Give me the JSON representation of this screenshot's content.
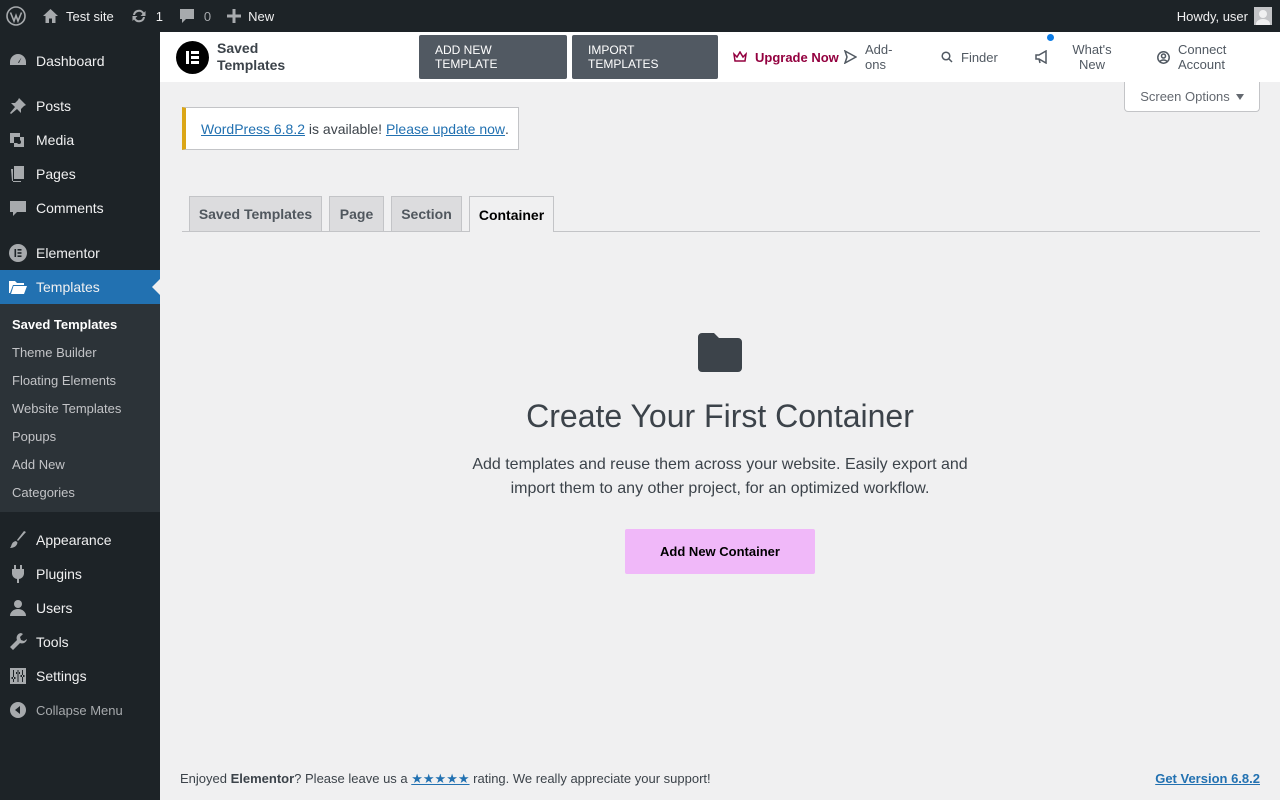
{
  "adminbar": {
    "site_name": "Test site",
    "updates_count": "1",
    "comments_count": "0",
    "new_label": "New",
    "howdy": "Howdy, user"
  },
  "sidebar": {
    "items_top": [
      {
        "label": "Dashboard",
        "icon": "dashboard-icon"
      }
    ],
    "items_mid": [
      {
        "label": "Posts",
        "icon": "pin-icon"
      },
      {
        "label": "Media",
        "icon": "media-icon"
      },
      {
        "label": "Pages",
        "icon": "pages-icon"
      },
      {
        "label": "Comments",
        "icon": "comment-icon"
      }
    ],
    "elementor": "Elementor",
    "templates": "Templates",
    "submenu": [
      "Saved Templates",
      "Theme Builder",
      "Floating Elements",
      "Website Templates",
      "Popups",
      "Add New",
      "Categories"
    ],
    "items_bottom": [
      {
        "label": "Appearance",
        "icon": "brush-icon"
      },
      {
        "label": "Plugins",
        "icon": "plug-icon"
      },
      {
        "label": "Users",
        "icon": "user-icon"
      },
      {
        "label": "Tools",
        "icon": "wrench-icon"
      },
      {
        "label": "Settings",
        "icon": "sliders-icon"
      }
    ],
    "collapse": "Collapse Menu"
  },
  "ebar": {
    "title": "Saved Templates",
    "add_new": "ADD NEW TEMPLATE",
    "import": "IMPORT TEMPLATES",
    "upgrade": "Upgrade Now",
    "addons": "Add-ons",
    "finder": "Finder",
    "whats_new": "What's New",
    "connect": "Connect Account"
  },
  "screen_options": "Screen Options",
  "notice": {
    "version_link": "WordPress 6.8.2",
    "middle": " is available! ",
    "update_link": "Please update now",
    "end": "."
  },
  "tabs": [
    "Saved Templates",
    "Page",
    "Section",
    "Container"
  ],
  "active_tab": "Container",
  "empty": {
    "title": "Create Your First Container",
    "description": "Add templates and reuse them across your website. Easily export and import them to any other project, for an optimized workflow.",
    "button": "Add New Container"
  },
  "footer": {
    "pre": "Enjoyed ",
    "brand": "Elementor",
    "mid": "? Please leave us a ",
    "stars": "★★★★★",
    "post": " rating. We really appreciate your support!",
    "version_link": "Get Version 6.8.2"
  },
  "colors": {
    "accent": "#2271b1",
    "adminbar": "#1d2327",
    "button_pink": "#f0b8f9",
    "upgrade": "#93003f"
  }
}
